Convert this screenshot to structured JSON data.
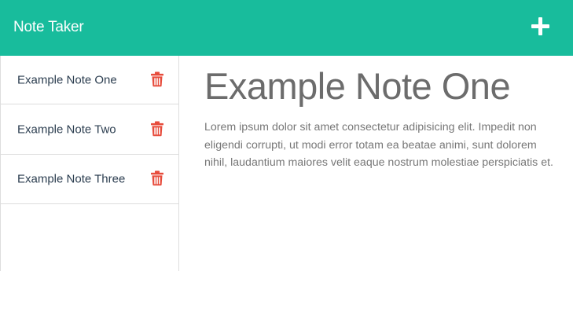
{
  "navbar": {
    "brand": "Note Taker",
    "new_note_icon": "plus-icon"
  },
  "sidebar": {
    "notes": [
      {
        "title": "Example Note One",
        "delete_icon": "trash-icon"
      },
      {
        "title": "Example Note Two",
        "delete_icon": "trash-icon"
      },
      {
        "title": "Example Note Three",
        "delete_icon": "trash-icon"
      }
    ]
  },
  "main": {
    "title": "Example Note One",
    "body": "Lorem ipsum dolor sit amet consectetur adipisicing elit. Impedit non eligendi corrupti, ut modi error totam ea beatae animi, sunt dolorem nihil, laudantium maiores velit eaque nostrum molestiae perspiciatis et."
  },
  "colors": {
    "navbar": "#18bc9c",
    "delete": "#e74c3c",
    "heading": "#6c6c6c",
    "body_text": "#777777"
  }
}
